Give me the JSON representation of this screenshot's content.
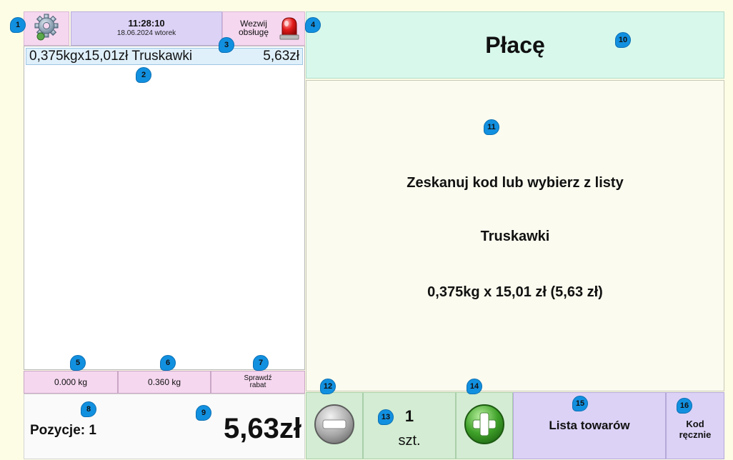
{
  "header": {
    "clock_time": "11:28:10",
    "clock_date": "18.06.2024 wtorek",
    "call_service_label": "Wezwij obsługę"
  },
  "receipt": {
    "items": [
      {
        "description": "0,375kgx15,01zł Truskawki",
        "amount": "5,63zł"
      }
    ]
  },
  "scales": {
    "weight_1": "0.000 kg",
    "weight_2": "0.360 kg",
    "check_discount_label": "Sprawdź rabat"
  },
  "summary": {
    "positions_label": "Pozycje: 1",
    "total": "5,63zł"
  },
  "pay": {
    "label": "Płacę"
  },
  "message": {
    "line1": "Zeskanuj kod lub wybierz z listy",
    "line2": "Truskawki",
    "line3": "0,375kg x 15,01 zł (5,63 zł)"
  },
  "quantity": {
    "value": "1",
    "unit": "szt."
  },
  "buttons": {
    "product_list_label": "Lista towarów",
    "manual_code_label": "Kod ręcznie"
  },
  "markers": [
    "1",
    "2",
    "3",
    "4",
    "5",
    "6",
    "7",
    "8",
    "9",
    "10",
    "11",
    "12",
    "13",
    "14",
    "15",
    "16"
  ],
  "icons": {
    "settings": "gear-icon",
    "alarm": "siren-icon",
    "minus": "minus-circle-icon",
    "plus": "plus-circle-icon"
  },
  "colors": {
    "marker": "#1290e0",
    "pay_bg": "#d8f8ec",
    "pink": "#f5d7ef",
    "lavender": "#dcd2f6",
    "green": "#d3ecd3"
  }
}
